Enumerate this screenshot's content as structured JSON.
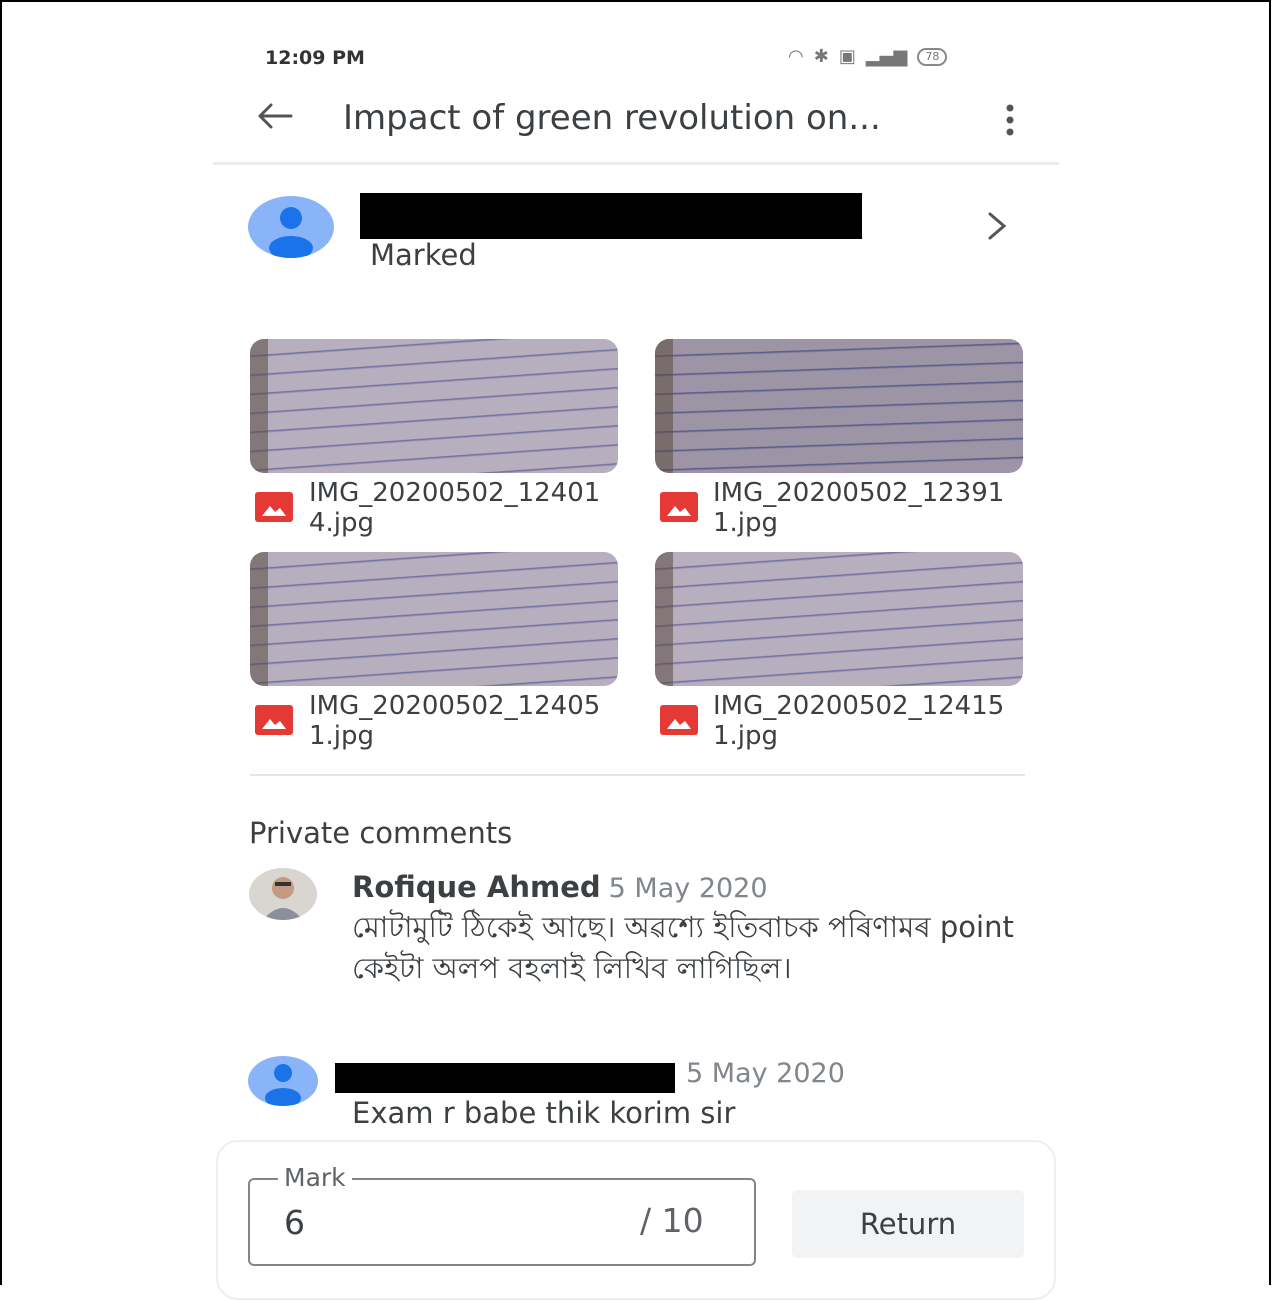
{
  "status_bar": {
    "time": "12:09 PM",
    "battery": "78"
  },
  "app_bar": {
    "title": "Impact of green revolution on..."
  },
  "student": {
    "status": "Marked"
  },
  "attachments": [
    {
      "name": "IMG_20200502_124014.jpg"
    },
    {
      "name": "IMG_20200502_123911.jpg"
    },
    {
      "name": "IMG_20200502_124051.jpg"
    },
    {
      "name": "IMG_20200502_124151.jpg"
    }
  ],
  "comments_section": {
    "title": "Private comments",
    "comments": [
      {
        "author": "Rofique Ahmed",
        "date": "5 May 2020",
        "text": "মোটামুটি ঠিকেই আছে। অৱশ্যে ইতিবাচক পৰিণামৰ point কেইটা অলপ বহলাই লিখিব লাগিছিল।"
      },
      {
        "date": "5 May 2020",
        "text": "Exam r babe thik korim sir"
      }
    ]
  },
  "grading": {
    "label": "Mark",
    "value": "6",
    "total": "/ 10",
    "return_label": "Return"
  }
}
